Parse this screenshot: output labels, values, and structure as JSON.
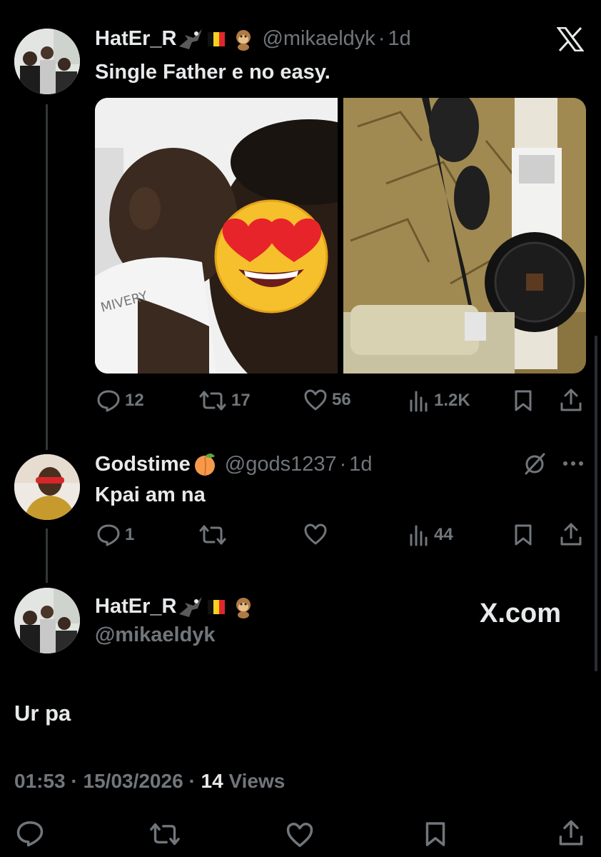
{
  "tweet1": {
    "name": "HatEr_R",
    "handle": "@mikaeldyk",
    "time": "1d",
    "text": "Single Father e no easy.",
    "stats": {
      "replies": "12",
      "reposts": "17",
      "likes": "56",
      "views": "1.2K"
    }
  },
  "tweet2": {
    "name": "Godstime",
    "handle": "@gods1237",
    "time": "1d",
    "text": "Kpai am na",
    "stats": {
      "replies": "1",
      "views": "44"
    }
  },
  "tweet3": {
    "name": "HatEr_R",
    "handle": "@mikaeldyk",
    "brand": "X.com",
    "text": "Ur pa",
    "time": "01:53",
    "date": "15/03/2026",
    "views_count": "14",
    "views_label": "Views"
  },
  "icons": [
    "x-logo-icon",
    "reply-icon",
    "repost-icon",
    "like-icon",
    "views-icon",
    "bookmark-icon",
    "share-icon",
    "grok-icon",
    "more-icon",
    "eagle-emoji",
    "belgium-flag-emoji",
    "monkey-emoji",
    "peach-emoji"
  ],
  "colors": {
    "background": "#000000",
    "text": "#e7e9ea",
    "muted": "#71767b",
    "divider": "#333639"
  }
}
